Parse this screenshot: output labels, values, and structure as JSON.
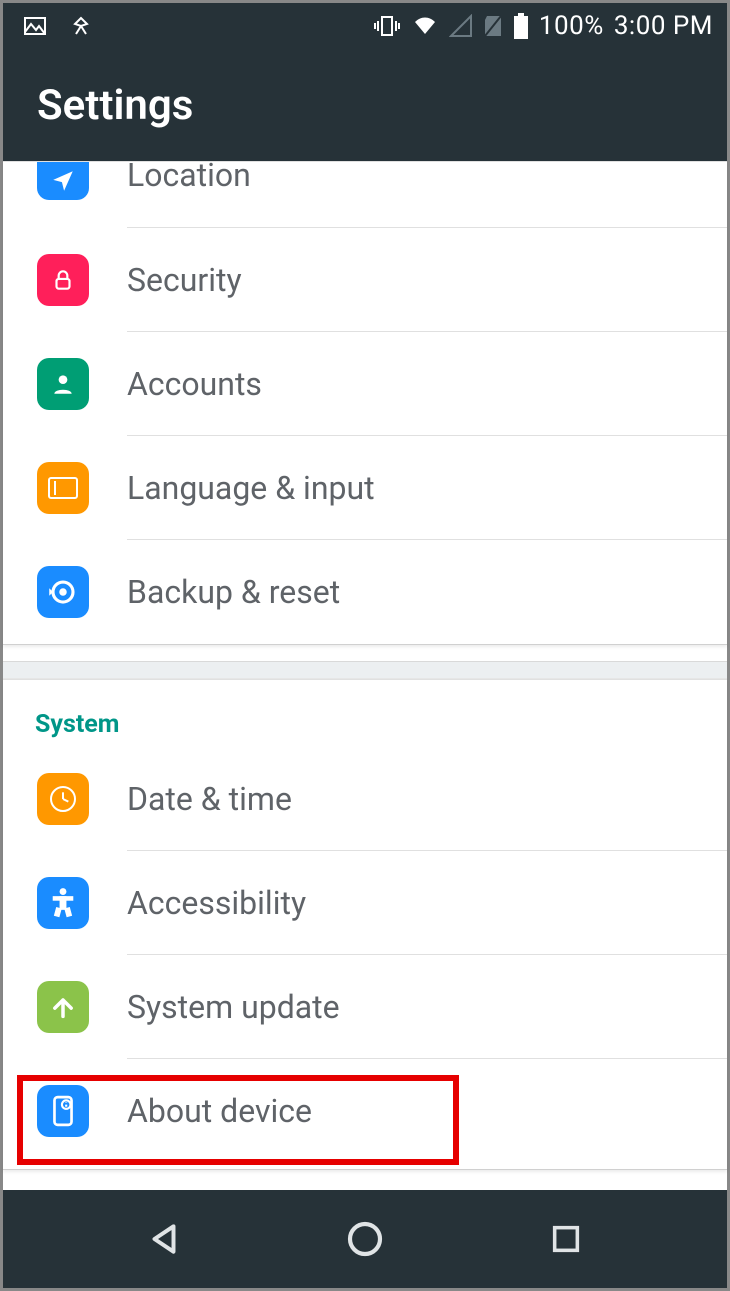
{
  "status": {
    "battery": "100%",
    "time": "3:00 PM"
  },
  "title": "Settings",
  "groups": [
    {
      "header": null,
      "items": [
        {
          "id": "location",
          "label": "Location",
          "color": "#1a8cff",
          "icon": "location"
        },
        {
          "id": "security",
          "label": "Security",
          "color": "#ff1f5a",
          "icon": "lock"
        },
        {
          "id": "accounts",
          "label": "Accounts",
          "color": "#009e74",
          "icon": "person"
        },
        {
          "id": "language-input",
          "label": "Language & input",
          "color": "#ff9800",
          "icon": "keyboard"
        },
        {
          "id": "backup-reset",
          "label": "Backup & reset",
          "color": "#1a8cff",
          "icon": "restore"
        }
      ]
    },
    {
      "header": "System",
      "items": [
        {
          "id": "date-time",
          "label": "Date & time",
          "color": "#ff9800",
          "icon": "clock"
        },
        {
          "id": "accessibility",
          "label": "Accessibility",
          "color": "#1a8cff",
          "icon": "accessibility"
        },
        {
          "id": "system-update",
          "label": "System update",
          "color": "#8bc34a",
          "icon": "arrow-up"
        },
        {
          "id": "about-device",
          "label": "About device",
          "color": "#1a8cff",
          "icon": "device-info",
          "highlighted": true
        }
      ]
    }
  ]
}
